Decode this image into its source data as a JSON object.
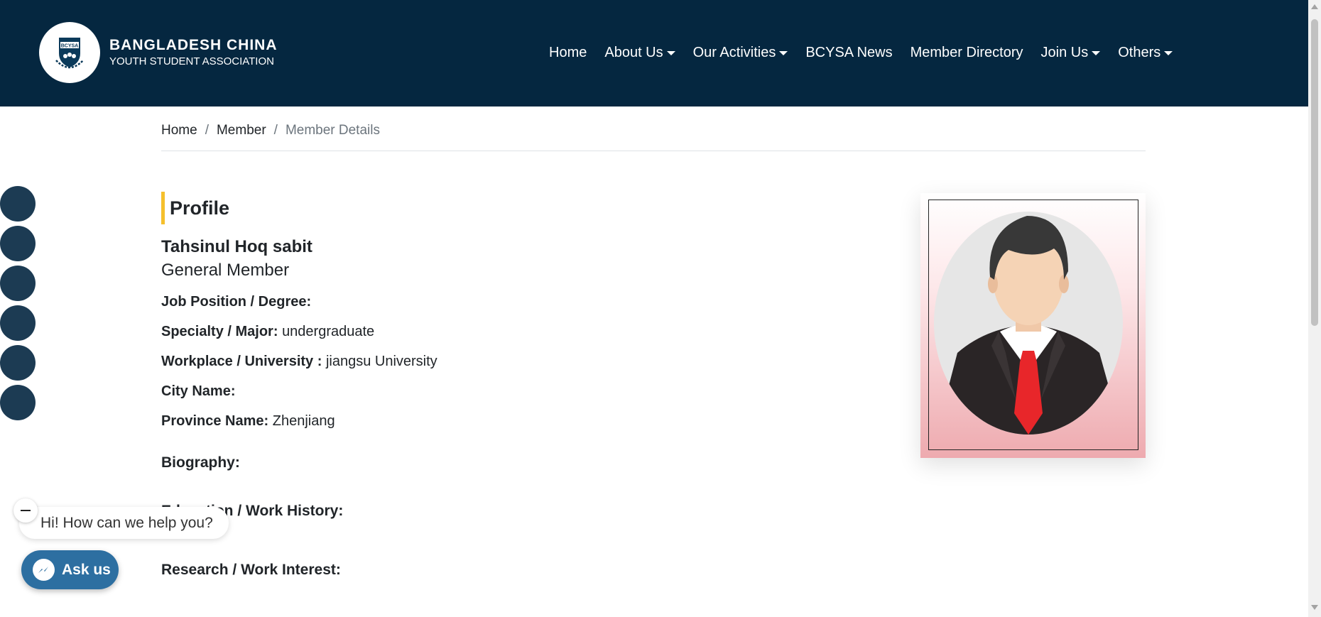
{
  "brand": {
    "line1": "BANGLADESH CHINA",
    "line2": "YOUTH STUDENT ASSOCIATION",
    "logo_text": "BCYSA"
  },
  "nav": {
    "items": [
      {
        "label": "Home",
        "dropdown": false
      },
      {
        "label": "About Us",
        "dropdown": true
      },
      {
        "label": "Our Activities",
        "dropdown": true
      },
      {
        "label": "BCYSA News",
        "dropdown": false
      },
      {
        "label": "Member Directory",
        "dropdown": false
      },
      {
        "label": "Join Us",
        "dropdown": true
      },
      {
        "label": "Others",
        "dropdown": true
      }
    ]
  },
  "breadcrumb": {
    "items": [
      "Home",
      "Member",
      "Member Details"
    ],
    "separator": "/"
  },
  "profile": {
    "heading": "Profile",
    "name": "Tahsinul Hoq sabit",
    "role": "General Member",
    "fields": [
      {
        "label": "Job Position / Degree:",
        "value": ""
      },
      {
        "label": "Specialty / Major:",
        "value": "undergraduate"
      },
      {
        "label": "Workplace / University :",
        "value": "jiangsu University"
      },
      {
        "label": "City Name:",
        "value": ""
      },
      {
        "label": "Province Name:",
        "value": "Zhenjiang"
      }
    ],
    "sections": {
      "biography": "Biography:",
      "work_history": "Education / Work History:",
      "research": "Research / Work Interest:"
    }
  },
  "chat": {
    "greeting": "Hi! How can we help you?",
    "button_label": "Ask us"
  },
  "colors": {
    "navbar_bg": "#052740",
    "accent": "#f5c02c",
    "social_bg": "#1c3b53",
    "chat_button": "#2d6fa1"
  }
}
